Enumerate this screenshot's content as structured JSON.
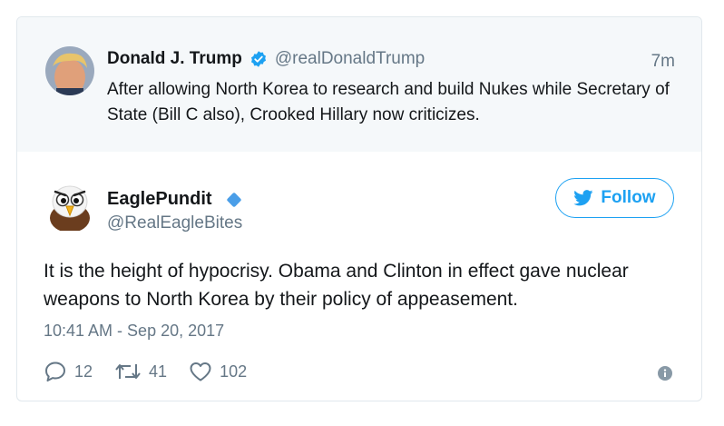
{
  "quoted_tweet": {
    "author_name": "Donald J. Trump",
    "handle": "@realDonaldTrump",
    "time": "7m",
    "text": "After allowing North Korea to research and build Nukes while Secretary of State (Bill C also), Crooked Hillary now criticizes."
  },
  "tweet": {
    "author_name": "EaglePundit",
    "handle": "@RealEagleBites",
    "follow_label": "Follow",
    "text": "It is the height of hypocrisy. Obama and Clinton in effect gave nuclear weapons to North Korea by their policy of appeasement.",
    "timestamp": "10:41 AM - Sep 20, 2017",
    "replies": "12",
    "retweets": "41",
    "likes": "102"
  },
  "colors": {
    "accent": "#1da1f2",
    "muted": "#657786",
    "text": "#14171a",
    "quoted_bg": "#f5f8fa",
    "border": "#e1e8ed"
  },
  "icons": {
    "verified": "verified-badge-icon",
    "follow": "twitter-bird-icon",
    "reply": "reply-icon",
    "retweet": "retweet-icon",
    "like": "heart-icon",
    "info": "info-icon"
  }
}
